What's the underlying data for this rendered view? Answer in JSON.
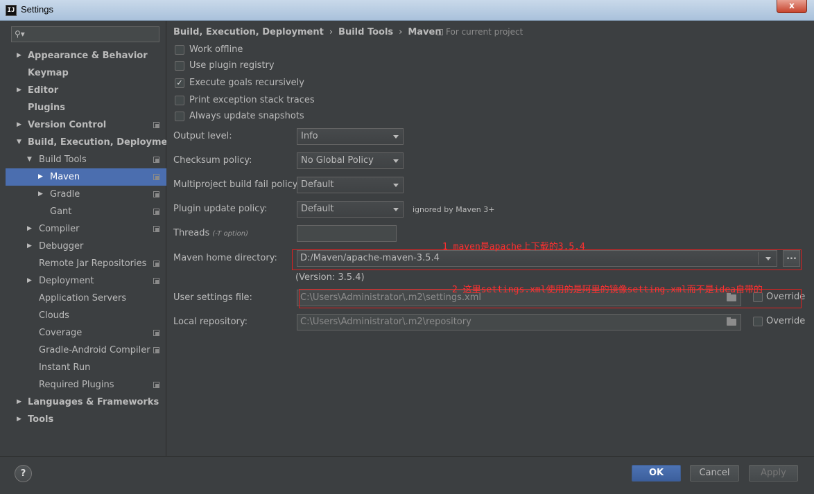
{
  "window": {
    "title": "Settings",
    "close_label": "x",
    "app_icon_text": "IJ"
  },
  "search": {
    "placeholder": ""
  },
  "sidebar": {
    "items": [
      {
        "label": "Appearance & Behavior",
        "bold": true,
        "arrow": "▶",
        "level": 0,
        "copy": false
      },
      {
        "label": "Keymap",
        "bold": true,
        "arrow": "",
        "level": 0,
        "copy": false
      },
      {
        "label": "Editor",
        "bold": true,
        "arrow": "▶",
        "level": 0,
        "copy": false
      },
      {
        "label": "Plugins",
        "bold": true,
        "arrow": "",
        "level": 0,
        "copy": false
      },
      {
        "label": "Version Control",
        "bold": true,
        "arrow": "▶",
        "level": 0,
        "copy": true
      },
      {
        "label": "Build, Execution, Deployment",
        "bold": true,
        "arrow": "▼",
        "level": 0,
        "copy": false
      },
      {
        "label": "Build Tools",
        "bold": false,
        "arrow": "▼",
        "level": 1,
        "copy": true
      },
      {
        "label": "Maven",
        "bold": false,
        "arrow": "▶",
        "level": 2,
        "copy": true,
        "selected": true
      },
      {
        "label": "Gradle",
        "bold": false,
        "arrow": "▶",
        "level": 2,
        "copy": true
      },
      {
        "label": "Gant",
        "bold": false,
        "arrow": "",
        "level": 2,
        "copy": true
      },
      {
        "label": "Compiler",
        "bold": false,
        "arrow": "▶",
        "level": 1,
        "copy": true
      },
      {
        "label": "Debugger",
        "bold": false,
        "arrow": "▶",
        "level": 1,
        "copy": false
      },
      {
        "label": "Remote Jar Repositories",
        "bold": false,
        "arrow": "",
        "level": 1,
        "copy": true
      },
      {
        "label": "Deployment",
        "bold": false,
        "arrow": "▶",
        "level": 1,
        "copy": true
      },
      {
        "label": "Application Servers",
        "bold": false,
        "arrow": "",
        "level": 1,
        "copy": false
      },
      {
        "label": "Clouds",
        "bold": false,
        "arrow": "",
        "level": 1,
        "copy": false
      },
      {
        "label": "Coverage",
        "bold": false,
        "arrow": "",
        "level": 1,
        "copy": true
      },
      {
        "label": "Gradle-Android Compiler",
        "bold": false,
        "arrow": "",
        "level": 1,
        "copy": true
      },
      {
        "label": "Instant Run",
        "bold": false,
        "arrow": "",
        "level": 1,
        "copy": false
      },
      {
        "label": "Required Plugins",
        "bold": false,
        "arrow": "",
        "level": 1,
        "copy": true
      },
      {
        "label": "Languages & Frameworks",
        "bold": true,
        "arrow": "▶",
        "level": 0,
        "copy": false
      },
      {
        "label": "Tools",
        "bold": true,
        "arrow": "▶",
        "level": 0,
        "copy": false
      }
    ]
  },
  "breadcrumb": {
    "part1": "Build, Execution, Deployment",
    "part2": "Build Tools",
    "part3": "Maven",
    "sep": "›"
  },
  "scope": {
    "label": "For current project"
  },
  "checkboxes": {
    "work_offline": {
      "label": "Work offline",
      "checked": false
    },
    "use_plugin_registry": {
      "label": "Use plugin registry",
      "checked": false
    },
    "execute_goals_recursively": {
      "label": "Execute goals recursively",
      "checked": true
    },
    "print_exception_stack_traces": {
      "label": "Print exception stack traces",
      "checked": false
    },
    "always_update_snapshots": {
      "label": "Always update snapshots",
      "checked": false
    }
  },
  "check_mark": "✓",
  "form": {
    "output_level": {
      "label": "Output level:",
      "value": "Info"
    },
    "checksum_policy": {
      "label": "Checksum policy:",
      "value": "No Global Policy"
    },
    "multiproject_fail_policy": {
      "label": "Multiproject build fail policy:",
      "value": "Default"
    },
    "plugin_update_policy": {
      "label": "Plugin update policy:",
      "value": "Default",
      "note": "ignored by Maven 3+"
    },
    "threads": {
      "label": "Threads",
      "hint": "(-T option)",
      "value": ""
    },
    "maven_home": {
      "label": "Maven home directory:",
      "value": "D:/Maven/apache-maven-3.5.4",
      "version": "(Version: 3.5.4)",
      "browse_label": "..."
    },
    "user_settings": {
      "label": "User settings file:",
      "value": "C:\\Users\\Administrator\\.m2\\settings.xml",
      "override_label": "Override"
    },
    "local_repository": {
      "label": "Local repository:",
      "value": "C:\\Users\\Administrator\\.m2\\repository",
      "override_label": "Override"
    }
  },
  "annotations": {
    "note1": "1 maven是apache上下载的3.5.4",
    "note2": "2 这里settings.xml使用的是阿里的镜像setting.xml而不是idea自带的"
  },
  "buttons": {
    "help": "?",
    "ok": "OK",
    "cancel": "Cancel",
    "apply": "Apply"
  },
  "colors": {
    "accent": "#4b6eaf",
    "annotation": "#e02020",
    "background": "#3c3f41"
  }
}
